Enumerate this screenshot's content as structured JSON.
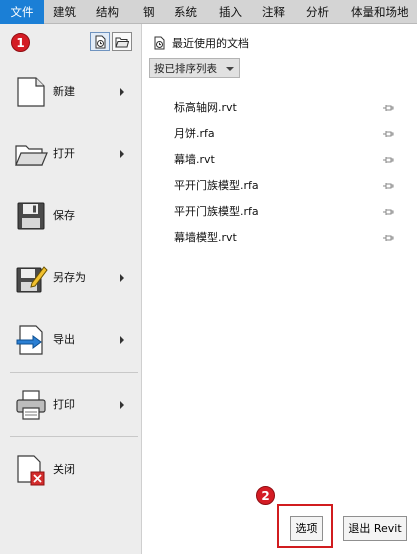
{
  "ribbon": {
    "tabs": [
      "文件",
      "建筑",
      "结构",
      "钢",
      "系统",
      "插入",
      "注释",
      "分析",
      "体量和场地"
    ],
    "active_tab": "文件"
  },
  "annotations": {
    "badge1": "1",
    "badge2": "2"
  },
  "app_menu": {
    "items": [
      {
        "label": "新建",
        "icon": "new-document-icon",
        "submenu": true
      },
      {
        "label": "打开",
        "icon": "open-folder-icon",
        "submenu": true
      },
      {
        "label": "保存",
        "icon": "floppy-save-icon",
        "submenu": false
      },
      {
        "label": "另存为",
        "icon": "save-as-icon",
        "submenu": true
      },
      {
        "label": "导出",
        "icon": "export-icon",
        "submenu": true
      },
      {
        "label": "打印",
        "icon": "printer-icon",
        "submenu": true
      },
      {
        "label": "关闭",
        "icon": "close-document-icon",
        "submenu": false
      }
    ]
  },
  "recent": {
    "title": "最近使用的文档",
    "sort_label": "按已排序列表",
    "documents": [
      "标高轴网.rvt",
      "月饼.rfa",
      "幕墙.rvt",
      "平开门族模型.rfa",
      "平开门族模型.rfa",
      "幕墙模型.rvt"
    ]
  },
  "footer": {
    "options_label": "选项",
    "exit_label": "退出 Revit"
  },
  "colors": {
    "active_tab": "#1b7fd6",
    "highlight": "#d11c1f",
    "badge": "#d41c24"
  }
}
